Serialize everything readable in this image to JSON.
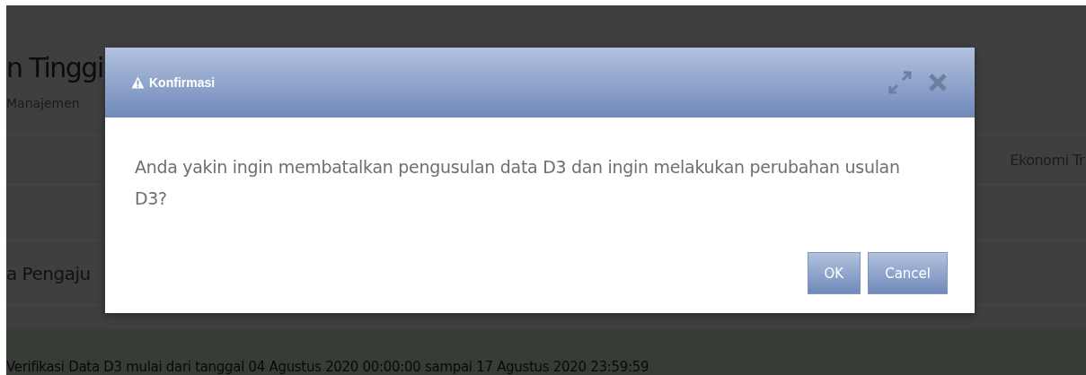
{
  "page": {
    "title": "n Tinggi",
    "subtitle": "Manajemen",
    "panel_text": "Ekonomi Tr",
    "section_heading": "a Pengaju",
    "notice": "Verifikasi Data D3 mulai dari tanggal 04 Agustus 2020 00:00:00 sampai 17 Agustus 2020 23:59:59"
  },
  "dialog": {
    "title": "Konfirmasi",
    "message": "Anda yakin ingin membatalkan pengusulan data D3 dan ingin melakukan perubahan usulan D3?",
    "buttons": [
      {
        "label": "OK"
      },
      {
        "label": "Cancel"
      }
    ]
  }
}
